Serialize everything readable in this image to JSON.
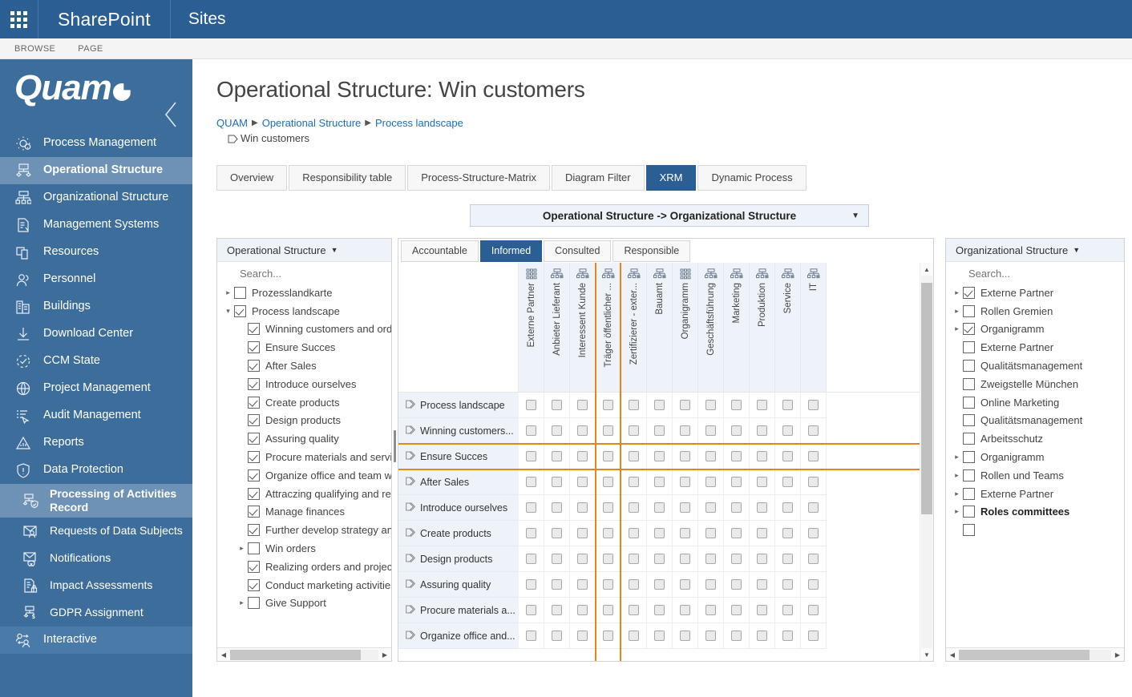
{
  "suitebar": {
    "waffle_icon": "waffle-icon",
    "brand": "SharePoint",
    "sites": "Sites"
  },
  "ribbon": {
    "tabs": [
      "BROWSE",
      "PAGE"
    ]
  },
  "leftnav": {
    "logo": "Quam",
    "collapse_icon": "chevron-left-icon",
    "items": [
      {
        "label": "Process Management",
        "icon": "gear-process-icon",
        "selected": false,
        "sub": false
      },
      {
        "label": "Operational Structure",
        "icon": "operational-structure-icon",
        "selected": true,
        "sub": false
      },
      {
        "label": "Organizational Structure",
        "icon": "org-chart-icon",
        "selected": false,
        "sub": false
      },
      {
        "label": "Management Systems",
        "icon": "document-check-icon",
        "selected": false,
        "sub": false
      },
      {
        "label": "Resources",
        "icon": "resources-icon",
        "selected": false,
        "sub": false
      },
      {
        "label": "Personnel",
        "icon": "people-icon",
        "selected": false,
        "sub": false
      },
      {
        "label": "Buildings",
        "icon": "building-icon",
        "selected": false,
        "sub": false
      },
      {
        "label": "Download Center",
        "icon": "download-icon",
        "selected": false,
        "sub": false
      },
      {
        "label": "CCM State",
        "icon": "ccm-state-icon",
        "selected": false,
        "sub": false
      },
      {
        "label": "Project Management",
        "icon": "globe-icon",
        "selected": false,
        "sub": false
      },
      {
        "label": "Audit Management",
        "icon": "audit-cursor-icon",
        "selected": false,
        "sub": false
      },
      {
        "label": "Reports",
        "icon": "chart-report-icon",
        "selected": false,
        "sub": false
      },
      {
        "label": "Data Protection",
        "icon": "shield-alert-icon",
        "selected": false,
        "sub": false
      },
      {
        "label": "Processing of Activities Record",
        "icon": "processing-activities-icon",
        "selected": true,
        "sub": true
      },
      {
        "label": "Requests of Data Subjects",
        "icon": "request-envelope-icon",
        "selected": false,
        "sub": true
      },
      {
        "label": "Notifications",
        "icon": "notification-envelope-icon",
        "selected": false,
        "sub": true
      },
      {
        "label": "Impact Assessments",
        "icon": "impact-lock-icon",
        "selected": false,
        "sub": true
      },
      {
        "label": "GDPR Assignment",
        "icon": "gdpr-assignment-icon",
        "selected": false,
        "sub": true
      },
      {
        "label": "Interactive",
        "icon": "interactive-users-icon",
        "selected": false,
        "sub": false
      }
    ]
  },
  "page": {
    "title": "Operational Structure: Win customers",
    "breadcrumb": [
      "QUAM",
      "Operational Structure",
      "Process landscape"
    ],
    "breadcrumb_leaf": "Win customers"
  },
  "tabs": [
    {
      "label": "Overview",
      "active": false
    },
    {
      "label": "Responsibility table",
      "active": false
    },
    {
      "label": "Process-Structure-Matrix",
      "active": false
    },
    {
      "label": "Diagram Filter",
      "active": false
    },
    {
      "label": "XRM",
      "active": true
    },
    {
      "label": "Dynamic Process",
      "active": false
    }
  ],
  "relation_selector": {
    "value": "Operational Structure -> Organizational Structure",
    "caret_icon": "chevron-down-icon"
  },
  "left_picker": {
    "header": "Operational Structure",
    "caret_icon": "chevron-down-icon",
    "search_placeholder": "Search...",
    "nodes": [
      {
        "label": "Prozesslandkarte",
        "checked": false,
        "indent": 0,
        "expander": "collapsed",
        "bold": false
      },
      {
        "label": "Process landscape",
        "checked": true,
        "indent": 0,
        "expander": "expanded",
        "bold": false
      },
      {
        "label": "Winning customers and orders",
        "checked": true,
        "indent": 1,
        "expander": "none",
        "bold": false
      },
      {
        "label": "Ensure Succes",
        "checked": true,
        "indent": 1,
        "expander": "none",
        "bold": false
      },
      {
        "label": "After Sales",
        "checked": true,
        "indent": 1,
        "expander": "none",
        "bold": false
      },
      {
        "label": "Introduce ourselves",
        "checked": true,
        "indent": 1,
        "expander": "none",
        "bold": false
      },
      {
        "label": "Create products",
        "checked": true,
        "indent": 1,
        "expander": "none",
        "bold": false
      },
      {
        "label": "Design products",
        "checked": true,
        "indent": 1,
        "expander": "none",
        "bold": false
      },
      {
        "label": "Assuring quality",
        "checked": true,
        "indent": 1,
        "expander": "none",
        "bold": false
      },
      {
        "label": "Procure materials and services",
        "checked": true,
        "indent": 1,
        "expander": "none",
        "bold": false
      },
      {
        "label": "Organize office and team work",
        "checked": true,
        "indent": 1,
        "expander": "none",
        "bold": false
      },
      {
        "label": "Attraczing qualifying and retaining",
        "checked": true,
        "indent": 1,
        "expander": "none",
        "bold": false
      },
      {
        "label": "Manage finances",
        "checked": true,
        "indent": 1,
        "expander": "none",
        "bold": false
      },
      {
        "label": "Further develop strategy and",
        "checked": true,
        "indent": 1,
        "expander": "none",
        "bold": false
      },
      {
        "label": "Win orders",
        "checked": false,
        "indent": 1,
        "expander": "collapsed",
        "bold": false
      },
      {
        "label": "Realizing orders and projects",
        "checked": true,
        "indent": 1,
        "expander": "none",
        "bold": false
      },
      {
        "label": "Conduct marketing activities",
        "checked": true,
        "indent": 1,
        "expander": "none",
        "bold": false
      },
      {
        "label": "Give Support",
        "checked": false,
        "indent": 1,
        "expander": "collapsed",
        "bold": false
      }
    ],
    "hscroll": {
      "left_arrow": "arrow-left-icon",
      "right_arrow": "arrow-right-icon",
      "thumb_pct": 88
    }
  },
  "matrix": {
    "tabs": [
      {
        "label": "Accountable",
        "active": false
      },
      {
        "label": "Informed",
        "active": true
      },
      {
        "label": "Consulted",
        "active": false
      },
      {
        "label": "Responsible",
        "active": false
      }
    ],
    "columns": [
      {
        "label": "Externe Partner",
        "icon": "org-group-icon",
        "mark": ""
      },
      {
        "label": "Anbieter Lieferant",
        "icon": "org-unit-icon",
        "mark": ""
      },
      {
        "label": "Interessent Kunde",
        "icon": "org-unit-icon",
        "mark": ""
      },
      {
        "label": "Träger öffentlicher ...",
        "icon": "org-unit-icon",
        "mark": "both"
      },
      {
        "label": "Zertifizierer - exter...",
        "icon": "org-unit-icon",
        "mark": ""
      },
      {
        "label": "Bauamt",
        "icon": "org-unit-icon",
        "mark": ""
      },
      {
        "label": "Organigramm",
        "icon": "org-group-icon",
        "mark": ""
      },
      {
        "label": "Geschäftsführung",
        "icon": "org-unit-icon",
        "mark": ""
      },
      {
        "label": "Marketing",
        "icon": "org-unit-icon",
        "mark": ""
      },
      {
        "label": "Produktion",
        "icon": "org-unit-icon",
        "mark": ""
      },
      {
        "label": "Service",
        "icon": "org-unit-icon",
        "mark": ""
      },
      {
        "label": "IT",
        "icon": "org-unit-icon",
        "mark": ""
      }
    ],
    "rows": [
      {
        "label": "Process landscape",
        "icon": "process-arrow-icon",
        "highlight": ""
      },
      {
        "label": "Winning customers...",
        "icon": "process-arrow-icon",
        "highlight": ""
      },
      {
        "label": "Ensure Succes",
        "icon": "process-arrow-icon",
        "highlight": "both"
      },
      {
        "label": "After Sales",
        "icon": "process-arrow-icon",
        "highlight": ""
      },
      {
        "label": "Introduce ourselves",
        "icon": "process-arrow-icon",
        "highlight": ""
      },
      {
        "label": "Create products",
        "icon": "process-arrow-icon",
        "highlight": ""
      },
      {
        "label": "Design products",
        "icon": "process-arrow-icon",
        "highlight": ""
      },
      {
        "label": "Assuring quality",
        "icon": "process-arrow-icon",
        "highlight": ""
      },
      {
        "label": "Procure materials a...",
        "icon": "process-arrow-icon",
        "highlight": ""
      },
      {
        "label": "Organize office and...",
        "icon": "process-arrow-icon",
        "highlight": ""
      }
    ],
    "cells_checked": false,
    "vscroll": {
      "up_arrow": "arrow-up-icon",
      "down_arrow": "arrow-down-icon",
      "thumb_top_pct": 2,
      "thumb_height_pct": 62
    }
  },
  "right_picker": {
    "header": "Organizational Structure",
    "caret_icon": "chevron-down-icon",
    "search_placeholder": "Search...",
    "nodes": [
      {
        "label": "Externe Partner",
        "checked": true,
        "expander": "collapsed",
        "bold": false
      },
      {
        "label": "Rollen Gremien",
        "checked": false,
        "expander": "collapsed",
        "bold": false
      },
      {
        "label": "Organigramm",
        "checked": true,
        "expander": "collapsed",
        "bold": false
      },
      {
        "label": "Externe Partner",
        "checked": false,
        "expander": "none",
        "bold": false
      },
      {
        "label": "Qualitätsmanagement",
        "checked": false,
        "expander": "none",
        "bold": false
      },
      {
        "label": "Zweigstelle München",
        "checked": false,
        "expander": "none",
        "bold": false
      },
      {
        "label": "Online Marketing",
        "checked": false,
        "expander": "none",
        "bold": false
      },
      {
        "label": "Qualitätsmanagement",
        "checked": false,
        "expander": "none",
        "bold": false
      },
      {
        "label": "Arbeitsschutz",
        "checked": false,
        "expander": "none",
        "bold": false
      },
      {
        "label": "Organigramm",
        "checked": false,
        "expander": "collapsed",
        "bold": false
      },
      {
        "label": "Rollen und Teams",
        "checked": false,
        "expander": "collapsed",
        "bold": false
      },
      {
        "label": "Externe Partner",
        "checked": false,
        "expander": "collapsed",
        "bold": false
      },
      {
        "label": "Roles committees",
        "checked": false,
        "expander": "collapsed",
        "bold": true
      },
      {
        "label": "",
        "checked": false,
        "expander": "none",
        "bold": false
      }
    ],
    "hscroll": {
      "left_arrow": "arrow-left-icon",
      "right_arrow": "arrow-right-icon",
      "thumb_pct": 86
    }
  },
  "colors": {
    "sharepoint_blue": "#2b5f93",
    "nav_blue": "#3d6e9b",
    "nav_selected": "#6d92b5",
    "accent_orange": "#e8851a",
    "panel_header": "#eef3fa",
    "link_blue": "#1b6ec2"
  }
}
